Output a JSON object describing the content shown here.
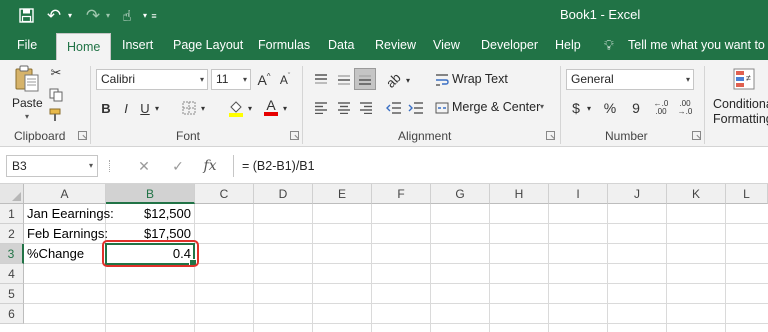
{
  "app": {
    "title": "Book1  -  Excel",
    "accent_color": "#217346",
    "quick_access": [
      {
        "name": "save-icon",
        "glyph": "🖫"
      },
      {
        "name": "undo-icon",
        "glyph": "↶"
      },
      {
        "name": "redo-icon",
        "glyph": "↷"
      },
      {
        "name": "touch-mode-icon",
        "glyph": "☝"
      },
      {
        "name": "customize-icon",
        "glyph": "⌄"
      }
    ]
  },
  "tabs": {
    "file": "File",
    "home": "Home",
    "insert": "Insert",
    "page_layout": "Page Layout",
    "formulas": "Formulas",
    "data": "Data",
    "review": "Review",
    "view": "View",
    "developer": "Developer",
    "help": "Help",
    "tell_me": "Tell me what you want to do"
  },
  "ribbon": {
    "clipboard": {
      "label": "Clipboard",
      "paste": "Paste"
    },
    "font": {
      "label": "Font",
      "name": "Calibri",
      "size": "11",
      "bold": "B",
      "italic": "I",
      "underline": "U",
      "grow": "A",
      "shrink": "A",
      "font_color": "A"
    },
    "alignment": {
      "label": "Alignment",
      "wrap_text": "Wrap Text",
      "merge_center": "Merge & Center"
    },
    "number": {
      "label": "Number",
      "format": "General",
      "currency": "$",
      "percent": "%",
      "comma": "9"
    },
    "styles": {
      "conditional_line1": "Conditional",
      "conditional_line2": "Formatting"
    }
  },
  "formula_bar": {
    "name_box": "B3",
    "cancel": "✕",
    "enter": "✓",
    "fx": "fx",
    "formula": "=  (B2-B1)/B1"
  },
  "grid": {
    "columns": [
      "A",
      "B",
      "C",
      "D",
      "E",
      "F",
      "G",
      "H",
      "I",
      "J",
      "K",
      "L"
    ],
    "rows": [
      "1",
      "2",
      "3",
      "4",
      "5",
      "6"
    ],
    "cells": {
      "A1": "Jan Eearnings:",
      "A2": "Feb Earnings:",
      "A3": "%Change",
      "B1": "$12,500",
      "B2": "$17,500",
      "B3": "0.4"
    },
    "selected_cell": "B3"
  }
}
